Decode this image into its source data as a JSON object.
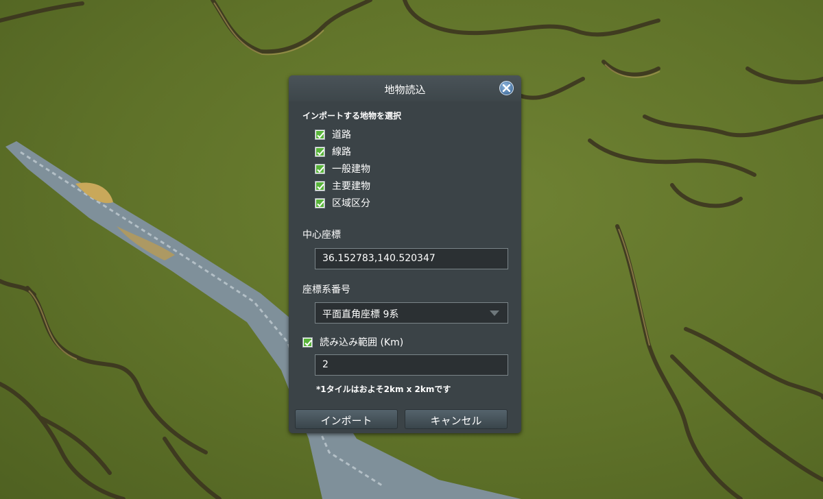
{
  "dialog": {
    "title": "地物読込",
    "section_label": "インポートする地物を選択",
    "features": [
      {
        "label": "道路",
        "checked": true
      },
      {
        "label": "線路",
        "checked": true
      },
      {
        "label": "一般建物",
        "checked": true
      },
      {
        "label": "主要建物",
        "checked": true
      },
      {
        "label": "区域区分",
        "checked": true
      }
    ],
    "center_coords_label": "中心座標",
    "center_coords_value": "36.152783,140.520347",
    "coord_system_label": "座標系番号",
    "coord_system_value": "平面直角座標 9系",
    "range_label": "読み込み範囲 (Km)",
    "range_checked": true,
    "range_value": "2",
    "note": "*1タイルはおよそ2km x 2kmです",
    "import_button": "インポート",
    "cancel_button": "キャンセル"
  },
  "icons": {
    "close": "close-icon",
    "check": "check-icon",
    "dropdown": "chevron-down-icon"
  },
  "colors": {
    "dialog_bg": "#3b4347",
    "check_green": "#58b33a",
    "close_blue": "#3a6ea5",
    "terrain": "#6a7d30",
    "water": "#8a9ba8"
  }
}
